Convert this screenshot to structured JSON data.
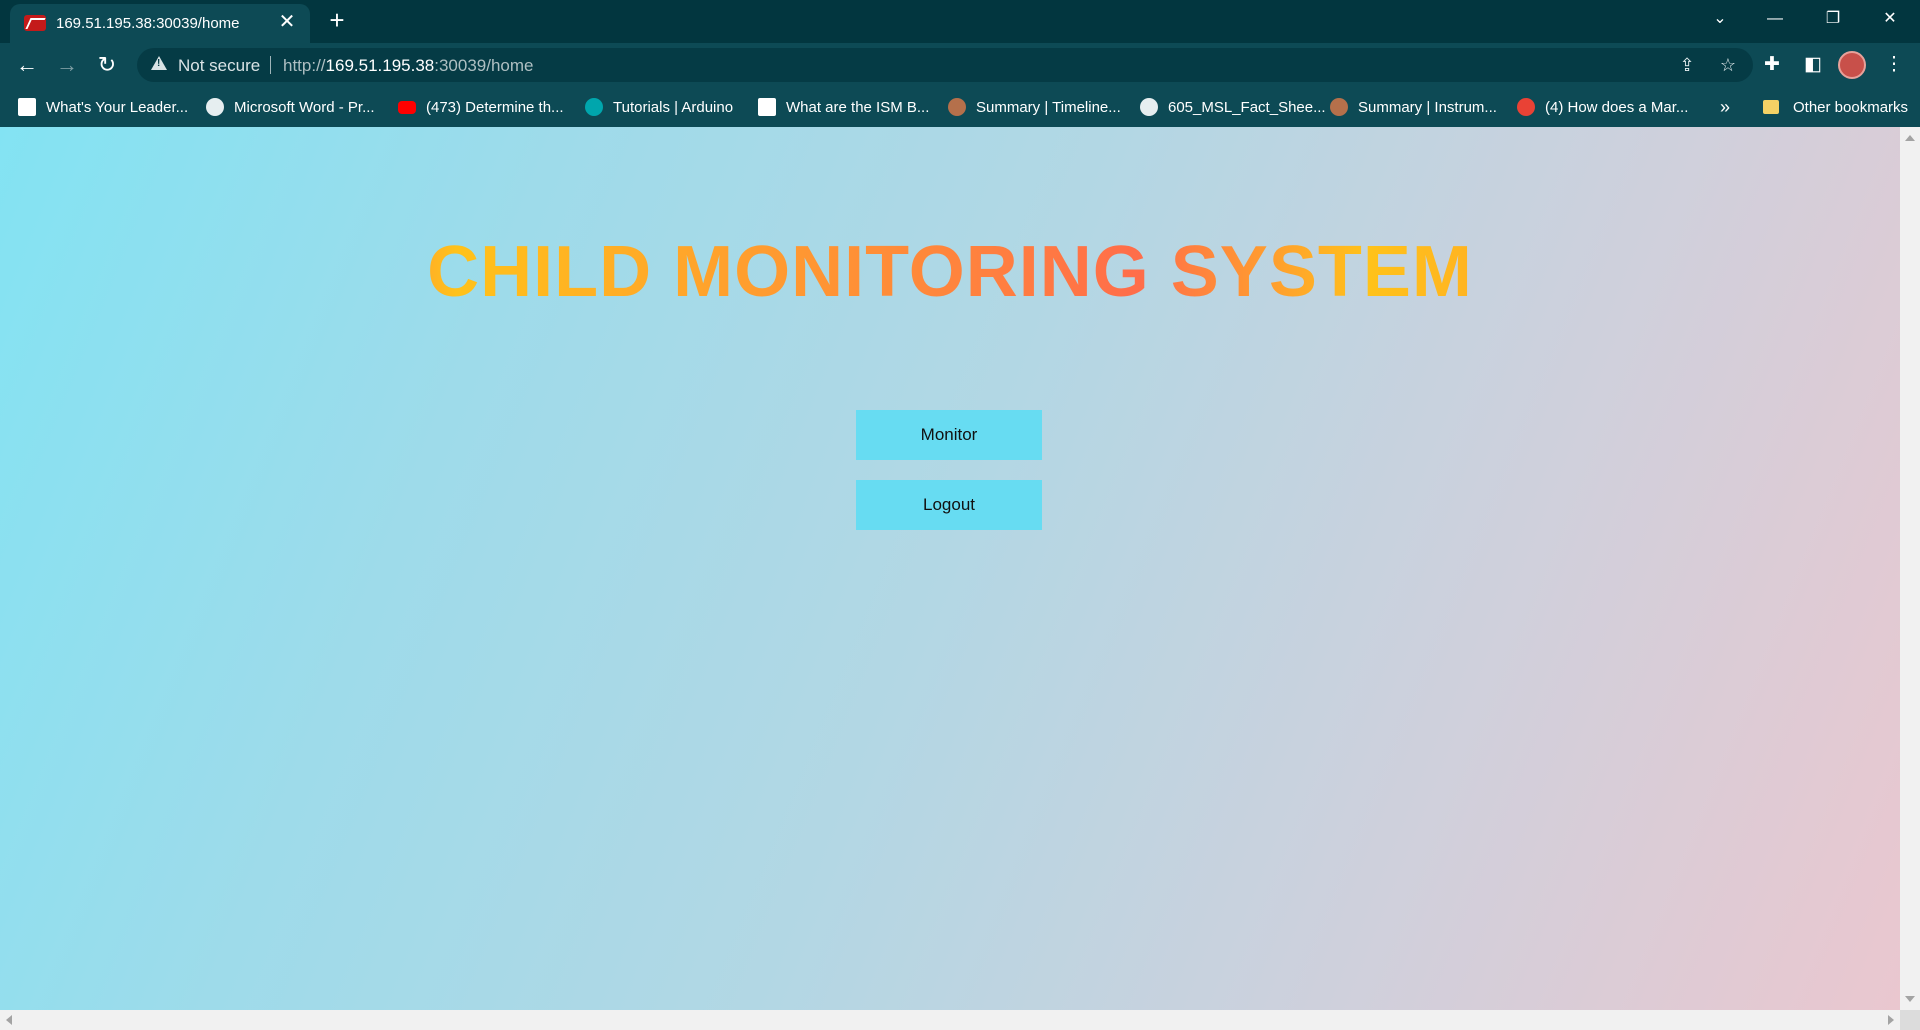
{
  "browser": {
    "tab": {
      "title": "169.51.195.38:30039/home"
    },
    "address": {
      "security_label": "Not secure",
      "url_scheme": "http://",
      "url_host": "169.51.195.38",
      "url_rest": ":30039/home"
    },
    "bookmarks": [
      {
        "label": "What's Your Leader...",
        "icon": "w-logo-icon",
        "color": "#ffffff"
      },
      {
        "label": "Microsoft Word - Pr...",
        "icon": "globe-icon",
        "color": "#e6eef0"
      },
      {
        "label": "(473) Determine th...",
        "icon": "youtube-icon",
        "color": "#ff0000"
      },
      {
        "label": "Tutorials | Arduino",
        "icon": "arduino-icon",
        "color": "#00a6ad"
      },
      {
        "label": "What are the ISM B...",
        "icon": "document-icon",
        "color": "#ffffff"
      },
      {
        "label": "Summary | Timeline...",
        "icon": "mars-icon",
        "color": "#b5704b"
      },
      {
        "label": "605_MSL_Fact_Shee...",
        "icon": "globe-icon",
        "color": "#e6eef0"
      },
      {
        "label": "Summary | Instrum...",
        "icon": "mars-icon",
        "color": "#b5704b"
      },
      {
        "label": "(4) How does a Mar...",
        "icon": "google-icon",
        "color": "#e94235"
      }
    ],
    "more_bookmarks": "»",
    "other_bookmarks": "Other bookmarks"
  },
  "page": {
    "title": "CHILD MONITORING SYSTEM",
    "buttons": {
      "monitor": "Monitor",
      "logout": "Logout"
    }
  },
  "colors": {
    "chrome_dark": "#02363f",
    "chrome": "#0d4a55",
    "button_bg": "#67dcf2",
    "title_orange": "#ff7a3c",
    "title_yellow": "#ffc21a"
  }
}
